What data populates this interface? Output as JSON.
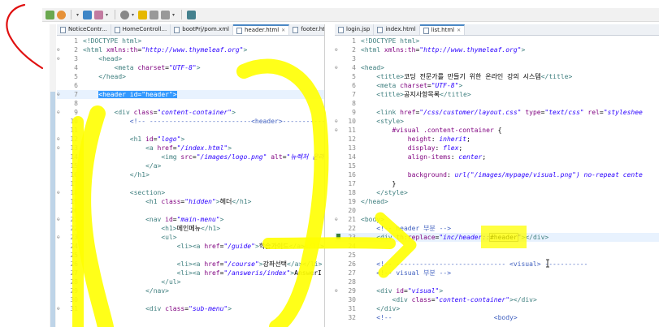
{
  "toolbar": {
    "icons": [
      "new-file-icon",
      "settings-gear-icon",
      "dropdown-icon",
      "tool-icon",
      "run-icon",
      "dropdown-icon",
      "search-icon",
      "dropdown-icon",
      "nav-icon",
      "back-icon",
      "forward-icon",
      "dropdown-icon",
      "external-icon"
    ]
  },
  "left_tabs": [
    {
      "label": "NoticeContr...",
      "active": false
    },
    {
      "label": "HomeControll...",
      "active": false
    },
    {
      "label": "bootPrj/pom.xml",
      "active": false
    },
    {
      "label": "header.html",
      "active": true
    },
    {
      "label": "footer.html",
      "active": false
    }
  ],
  "right_tabs": [
    {
      "label": "login.jsp",
      "active": false
    },
    {
      "label": "index.html",
      "active": false
    },
    {
      "label": "list.html",
      "active": true
    }
  ],
  "left_lines": [
    {
      "n": "1",
      "f": "",
      "t": [
        [
          "tag",
          "<!DOCTYPE html>"
        ]
      ]
    },
    {
      "n": "2",
      "f": "⊖",
      "t": [
        [
          "tag",
          "<html "
        ],
        [
          "attr",
          "xmlns:th"
        ],
        [
          "txt",
          "="
        ],
        [
          "val",
          "\"http://www.thymeleaf.org\""
        ],
        [
          "tag",
          ">"
        ]
      ]
    },
    {
      "n": "3",
      "f": "⊖",
      "t": [
        [
          "txt",
          "    "
        ],
        [
          "tag",
          "<head>"
        ]
      ]
    },
    {
      "n": "4",
      "f": "",
      "t": [
        [
          "txt",
          "        "
        ],
        [
          "tag",
          "<meta "
        ],
        [
          "attr",
          "charset"
        ],
        [
          "txt",
          "="
        ],
        [
          "val",
          "\"UTF-8\""
        ],
        [
          "tag",
          ">"
        ]
      ]
    },
    {
      "n": "5",
      "f": "",
      "t": [
        [
          "txt",
          "    "
        ],
        [
          "tag",
          "</head>"
        ]
      ]
    },
    {
      "n": "6",
      "f": "",
      "t": []
    },
    {
      "n": "7",
      "f": "⊖",
      "hl": true,
      "t": [
        [
          "txt",
          "    "
        ],
        [
          "sel",
          "<header id=\"header\">"
        ]
      ]
    },
    {
      "n": "8",
      "f": "",
      "t": []
    },
    {
      "n": "9",
      "f": "⊖",
      "t": [
        [
          "txt",
          "        "
        ],
        [
          "tag",
          "<div "
        ],
        [
          "attr",
          "class"
        ],
        [
          "txt",
          "="
        ],
        [
          "val",
          "\"content-container\""
        ],
        [
          "tag",
          ">"
        ]
      ]
    },
    {
      "n": "10",
      "f": "",
      "t": [
        [
          "txt",
          "            "
        ],
        [
          "cmt",
          "<!-- --------------------------<header>-----------"
        ]
      ]
    },
    {
      "n": "11",
      "f": "",
      "t": []
    },
    {
      "n": "12",
      "f": "⊖",
      "t": [
        [
          "txt",
          "            "
        ],
        [
          "tag",
          "<h1 "
        ],
        [
          "attr",
          "id"
        ],
        [
          "txt",
          "="
        ],
        [
          "val",
          "\"logo\""
        ],
        [
          "tag",
          ">"
        ]
      ]
    },
    {
      "n": "13",
      "f": "⊖",
      "t": [
        [
          "txt",
          "                "
        ],
        [
          "tag",
          "<a "
        ],
        [
          "attr",
          "href"
        ],
        [
          "txt",
          "="
        ],
        [
          "val",
          "\"/index.html\""
        ],
        [
          "tag",
          ">"
        ]
      ]
    },
    {
      "n": "14",
      "f": "",
      "t": [
        [
          "txt",
          "                    "
        ],
        [
          "tag",
          "<img "
        ],
        [
          "attr",
          "src"
        ],
        [
          "txt",
          "="
        ],
        [
          "val",
          "\"/images/logo.png\""
        ],
        [
          "txt",
          " "
        ],
        [
          "attr",
          "alt"
        ],
        [
          "txt",
          "="
        ],
        [
          "val",
          "\"뉴렉처 온라"
        ]
      ]
    },
    {
      "n": "15",
      "f": "",
      "t": [
        [
          "txt",
          "                "
        ],
        [
          "tag",
          "</a>"
        ]
      ]
    },
    {
      "n": "16",
      "f": "",
      "t": [
        [
          "txt",
          "            "
        ],
        [
          "tag",
          "</h1>"
        ]
      ]
    },
    {
      "n": "17",
      "f": "",
      "t": []
    },
    {
      "n": "18",
      "f": "⊖",
      "t": [
        [
          "txt",
          "            "
        ],
        [
          "tag",
          "<section>"
        ]
      ]
    },
    {
      "n": "19",
      "f": "",
      "t": [
        [
          "txt",
          "                "
        ],
        [
          "tag",
          "<h1 "
        ],
        [
          "attr",
          "class"
        ],
        [
          "txt",
          "="
        ],
        [
          "val",
          "\"hidden\""
        ],
        [
          "tag",
          ">"
        ],
        [
          "txt",
          "헤더"
        ],
        [
          "tag",
          "</h1>"
        ]
      ]
    },
    {
      "n": "20",
      "f": "",
      "t": []
    },
    {
      "n": "21",
      "f": "⊖",
      "t": [
        [
          "txt",
          "                "
        ],
        [
          "tag",
          "<nav "
        ],
        [
          "attr",
          "id"
        ],
        [
          "txt",
          "="
        ],
        [
          "val",
          "\"main-menu\""
        ],
        [
          "tag",
          ">"
        ]
      ]
    },
    {
      "n": "22",
      "f": "",
      "t": [
        [
          "txt",
          "                    "
        ],
        [
          "tag",
          "<h1>"
        ],
        [
          "txt",
          "메인메뉴"
        ],
        [
          "tag",
          "</h1>"
        ]
      ]
    },
    {
      "n": "23",
      "f": "⊖",
      "t": [
        [
          "txt",
          "                    "
        ],
        [
          "tag",
          "<ul>"
        ]
      ]
    },
    {
      "n": "24",
      "f": "",
      "t": [
        [
          "txt",
          "                        "
        ],
        [
          "tag",
          "<li>"
        ],
        [
          "tag",
          "<a "
        ],
        [
          "attr",
          "href"
        ],
        [
          "txt",
          "="
        ],
        [
          "val",
          "\"/guide\""
        ],
        [
          "tag",
          ">"
        ],
        [
          "txt",
          "학습가이드"
        ],
        [
          "tag",
          "</a></li>"
        ]
      ]
    },
    {
      "n": "25",
      "f": "",
      "t": []
    },
    {
      "n": "26",
      "f": "",
      "t": [
        [
          "txt",
          "                        "
        ],
        [
          "tag",
          "<li>"
        ],
        [
          "tag",
          "<a "
        ],
        [
          "attr",
          "href"
        ],
        [
          "txt",
          "="
        ],
        [
          "val",
          "\"/course\""
        ],
        [
          "tag",
          ">"
        ],
        [
          "txt",
          "강좌선택"
        ],
        [
          "tag",
          "</a></li>"
        ]
      ]
    },
    {
      "n": "27",
      "f": "",
      "t": [
        [
          "txt",
          "                        "
        ],
        [
          "tag",
          "<li>"
        ],
        [
          "tag",
          "<a "
        ],
        [
          "attr",
          "href"
        ],
        [
          "txt",
          "="
        ],
        [
          "val",
          "\"/answeris/index\""
        ],
        [
          "tag",
          ">"
        ],
        [
          "txt",
          "AnswerI"
        ]
      ]
    },
    {
      "n": "28",
      "f": "",
      "t": [
        [
          "txt",
          "                    "
        ],
        [
          "tag",
          "</ul>"
        ]
      ]
    },
    {
      "n": "29",
      "f": "",
      "t": [
        [
          "txt",
          "                "
        ],
        [
          "tag",
          "</nav>"
        ]
      ]
    },
    {
      "n": "30",
      "f": "",
      "t": []
    },
    {
      "n": "31",
      "f": "⊖",
      "t": [
        [
          "txt",
          "                "
        ],
        [
          "tag",
          "<div "
        ],
        [
          "attr",
          "class"
        ],
        [
          "txt",
          "="
        ],
        [
          "val",
          "\"sub-menu\""
        ],
        [
          "tag",
          ">"
        ]
      ]
    }
  ],
  "right_lines": [
    {
      "n": "1",
      "f": "",
      "t": [
        [
          "tag",
          "<!DOCTYPE html>"
        ]
      ]
    },
    {
      "n": "2",
      "f": "⊖",
      "t": [
        [
          "tag",
          "<html "
        ],
        [
          "attr",
          "xmlns:th"
        ],
        [
          "txt",
          "="
        ],
        [
          "val",
          "\"http://www.thymeleaf.org\""
        ],
        [
          "tag",
          ">"
        ]
      ]
    },
    {
      "n": "3",
      "f": "",
      "t": []
    },
    {
      "n": "4",
      "f": "⊖",
      "t": [
        [
          "tag",
          "<head>"
        ]
      ]
    },
    {
      "n": "5",
      "f": "",
      "t": [
        [
          "txt",
          "    "
        ],
        [
          "tag",
          "<title>"
        ],
        [
          "txt",
          "코딩 전문가를 만들기 위한 온라인 강의 시스템"
        ],
        [
          "tag",
          "</title>"
        ]
      ]
    },
    {
      "n": "6",
      "f": "",
      "t": [
        [
          "txt",
          "    "
        ],
        [
          "tag",
          "<meta "
        ],
        [
          "attr",
          "charset"
        ],
        [
          "txt",
          "="
        ],
        [
          "val",
          "\"UTF-8\""
        ],
        [
          "tag",
          ">"
        ]
      ]
    },
    {
      "n": "7",
      "f": "",
      "t": [
        [
          "txt",
          "    "
        ],
        [
          "tag",
          "<title>"
        ],
        [
          "txt",
          "공지사항목록"
        ],
        [
          "tag",
          "</title>"
        ]
      ]
    },
    {
      "n": "8",
      "f": "",
      "t": []
    },
    {
      "n": "9",
      "f": "",
      "t": [
        [
          "txt",
          "    "
        ],
        [
          "tag",
          "<link "
        ],
        [
          "attr",
          "href"
        ],
        [
          "txt",
          "="
        ],
        [
          "val",
          "\"/css/customer/layout.css\""
        ],
        [
          "txt",
          " "
        ],
        [
          "attr",
          "type"
        ],
        [
          "txt",
          "="
        ],
        [
          "val",
          "\"text/css\""
        ],
        [
          "txt",
          " "
        ],
        [
          "attr",
          "rel"
        ],
        [
          "txt",
          "="
        ],
        [
          "val",
          "\"styleshee"
        ]
      ]
    },
    {
      "n": "10",
      "f": "⊖",
      "t": [
        [
          "txt",
          "    "
        ],
        [
          "tag",
          "<style>"
        ]
      ]
    },
    {
      "n": "11",
      "f": "⊖",
      "t": [
        [
          "txt",
          "        "
        ],
        [
          "attr",
          "#visual .content-container"
        ],
        [
          "txt",
          " {"
        ]
      ]
    },
    {
      "n": "12",
      "f": "",
      "t": [
        [
          "txt",
          "            "
        ],
        [
          "attr",
          "height"
        ],
        [
          "txt",
          ": "
        ],
        [
          "val",
          "inherit"
        ],
        [
          "txt",
          ";"
        ]
      ]
    },
    {
      "n": "13",
      "f": "",
      "t": [
        [
          "txt",
          "            "
        ],
        [
          "attr",
          "display"
        ],
        [
          "txt",
          ": "
        ],
        [
          "val",
          "flex"
        ],
        [
          "txt",
          ";"
        ]
      ]
    },
    {
      "n": "14",
      "f": "",
      "t": [
        [
          "txt",
          "            "
        ],
        [
          "attr",
          "align-items"
        ],
        [
          "txt",
          ": "
        ],
        [
          "val",
          "center"
        ],
        [
          "txt",
          ";"
        ]
      ]
    },
    {
      "n": "15",
      "f": "",
      "t": []
    },
    {
      "n": "16",
      "f": "",
      "t": [
        [
          "txt",
          "            "
        ],
        [
          "attr",
          "background"
        ],
        [
          "txt",
          ": "
        ],
        [
          "val",
          "url(\"/images/mypage/visual.png\") no-repeat cente"
        ]
      ]
    },
    {
      "n": "17",
      "f": "",
      "t": [
        [
          "txt",
          "        "
        ],
        [
          "txt",
          "}"
        ]
      ]
    },
    {
      "n": "18",
      "f": "",
      "t": [
        [
          "txt",
          "    "
        ],
        [
          "tag",
          "</style>"
        ]
      ]
    },
    {
      "n": "19",
      "f": "",
      "t": [
        [
          "tag",
          "</head>"
        ]
      ]
    },
    {
      "n": "20",
      "f": "",
      "t": []
    },
    {
      "n": "21",
      "f": "⊖",
      "t": [
        [
          "tag",
          "<body>"
        ]
      ]
    },
    {
      "n": "22",
      "f": "",
      "t": [
        [
          "txt",
          "    "
        ],
        [
          "cmt",
          "<!-- header 부분 -->"
        ]
      ]
    },
    {
      "n": "23",
      "f": "",
      "hl": true,
      "t": [
        [
          "txt",
          "    "
        ],
        [
          "tag",
          "<div "
        ],
        [
          "attr",
          "th:replace"
        ],
        [
          "txt",
          "="
        ],
        [
          "val",
          "\"inc/header::"
        ],
        [
          "find",
          "#header"
        ],
        [
          "val",
          "\""
        ],
        [
          "tag",
          "></div>"
        ]
      ]
    },
    {
      "n": "24",
      "f": "",
      "t": []
    },
    {
      "n": "25",
      "f": "",
      "t": []
    },
    {
      "n": "26",
      "f": "",
      "t": [
        [
          "txt",
          "    "
        ],
        [
          "cmt",
          "<!-- ---------------------------- <visual> -----------"
        ]
      ]
    },
    {
      "n": "27",
      "f": "",
      "t": [
        [
          "txt",
          "    "
        ],
        [
          "cmt",
          "<!-- visual 부분 -->"
        ]
      ]
    },
    {
      "n": "28",
      "f": "",
      "t": []
    },
    {
      "n": "29",
      "f": "⊖",
      "t": [
        [
          "txt",
          "    "
        ],
        [
          "tag",
          "<div "
        ],
        [
          "attr",
          "id"
        ],
        [
          "txt",
          "="
        ],
        [
          "val",
          "\"visual\""
        ],
        [
          "tag",
          ">"
        ]
      ]
    },
    {
      "n": "30",
      "f": "",
      "t": [
        [
          "txt",
          "        "
        ],
        [
          "tag",
          "<div "
        ],
        [
          "attr",
          "class"
        ],
        [
          "txt",
          "="
        ],
        [
          "val",
          "\"content-container\""
        ],
        [
          "tag",
          "></div>"
        ]
      ]
    },
    {
      "n": "31",
      "f": "",
      "t": [
        [
          "txt",
          "    "
        ],
        [
          "tag",
          "</div>"
        ]
      ]
    },
    {
      "n": "32",
      "f": "",
      "t": [
        [
          "txt",
          "    "
        ],
        [
          "cmt",
          "<!--                          <body>"
        ]
      ]
    }
  ]
}
